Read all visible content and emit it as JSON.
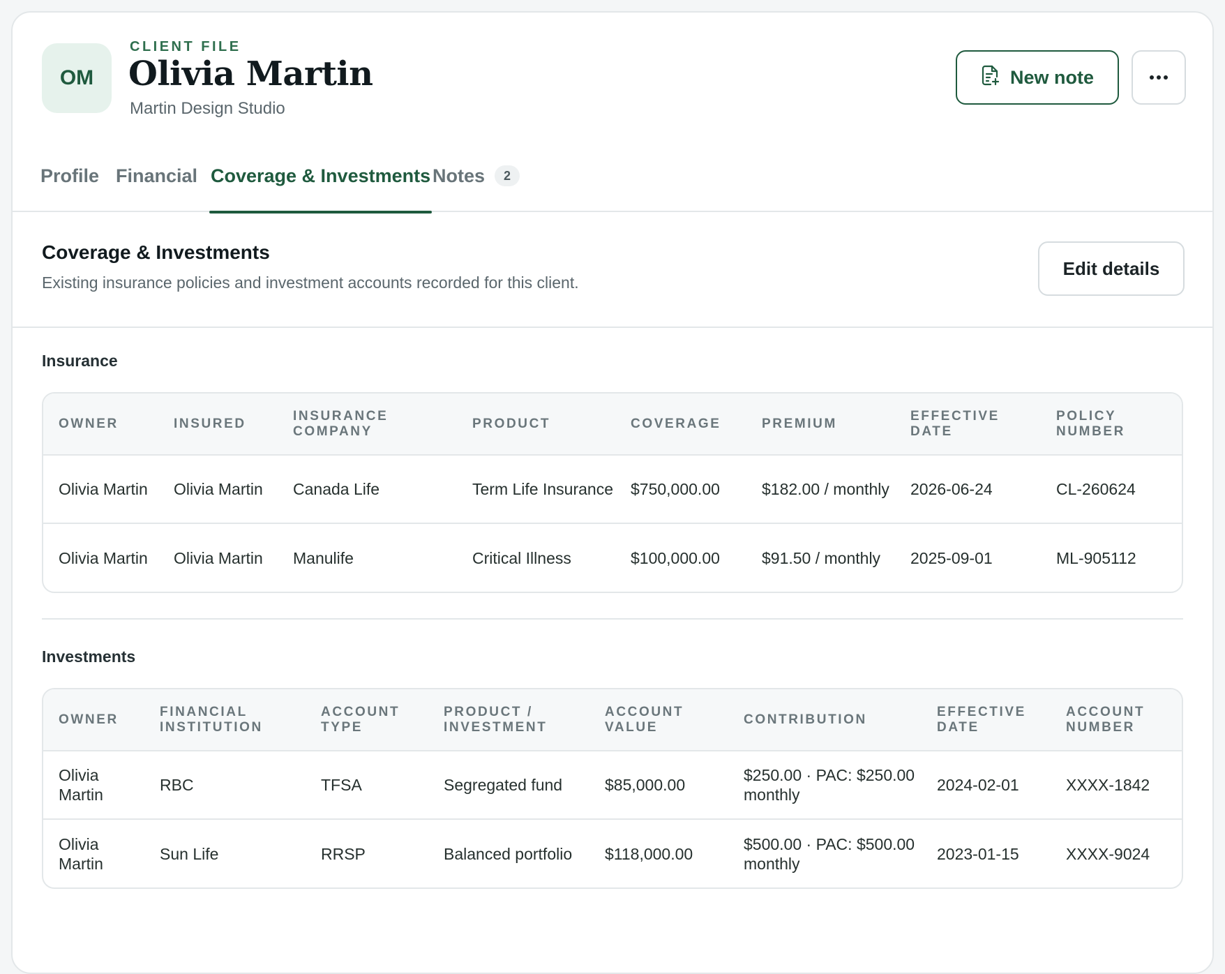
{
  "header": {
    "avatar_initials": "OM",
    "eyebrow": "CLIENT FILE",
    "name": "Olivia Martin",
    "company": "Martin Design Studio",
    "new_note_label": "New note",
    "more_icon": "ellipsis-icon",
    "new_note_icon": "file-plus-icon"
  },
  "tabs": [
    {
      "label": "Profile",
      "active": false
    },
    {
      "label": "Financial",
      "active": false
    },
    {
      "label": "Coverage & Investments",
      "active": true
    },
    {
      "label": "Notes",
      "badge": "2",
      "active": false
    }
  ],
  "section": {
    "title": "Coverage & Investments",
    "subtitle": "Existing insurance policies and investment accounts recorded for this client.",
    "edit_label": "Edit details"
  },
  "insurance": {
    "label": "Insurance",
    "columns": [
      "Owner",
      "Insured",
      "Insurance Company",
      "Product",
      "Coverage",
      "Premium",
      "Effective Date",
      "Policy Number"
    ],
    "rows": [
      [
        "Olivia Martin",
        "Olivia Martin",
        "Canada Life",
        "Term Life Insurance",
        "$750,000.00",
        "$182.00 / monthly",
        "2026-06-24",
        "CL-260624"
      ],
      [
        "Olivia Martin",
        "Olivia Martin",
        "Manulife",
        "Critical Illness",
        "$100,000.00",
        "$91.50 / monthly",
        "2025-09-01",
        "ML-905112"
      ]
    ]
  },
  "investments": {
    "label": "Investments",
    "columns": [
      "Owner",
      "Financial Institution",
      "Account Type",
      "Product / Investment",
      "Account Value",
      "Contribution",
      "Effective Date",
      "Account Number"
    ],
    "rows": [
      [
        "Olivia Martin",
        "RBC",
        "TFSA",
        "Segregated fund",
        "$85,000.00",
        "$250.00 · PAC: $250.00 monthly",
        "2024-02-01",
        "XXXX-1842"
      ],
      [
        "Olivia Martin",
        "Sun Life",
        "RRSP",
        "Balanced portfolio",
        "$118,000.00",
        "$500.00 · PAC: $500.00 monthly",
        "2023-01-15",
        "XXXX-9024"
      ]
    ]
  },
  "colors": {
    "brand": "#1f5a3e",
    "accent_text": "#2f6f4e",
    "avatar_bg": "#e6f2ec",
    "border": "#e3e7e9"
  }
}
